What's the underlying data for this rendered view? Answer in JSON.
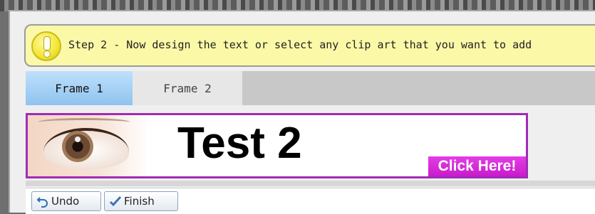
{
  "step": {
    "text": "Step 2 - Now design the text or select any clip art that you want to add",
    "icon": "exclamation-icon"
  },
  "tabs": [
    {
      "label": "Frame 1",
      "active": true
    },
    {
      "label": "Frame 2",
      "active": false
    }
  ],
  "banner": {
    "headline": "Test 2",
    "cta_label": "Click Here!",
    "border_color": "#a12bb6",
    "cta_color": "#d42bd6"
  },
  "toolbar": {
    "undo_label": "Undo",
    "finish_label": "Finish"
  }
}
